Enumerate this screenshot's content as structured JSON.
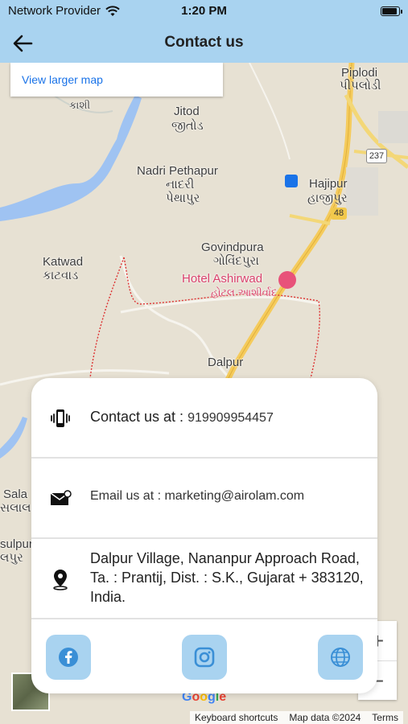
{
  "status_bar": {
    "carrier": "Network Provider",
    "time": "1:20 PM",
    "battery_level": 0.95
  },
  "header": {
    "title": "Contact us",
    "back_icon": "arrow-left-icon"
  },
  "map": {
    "view_larger_map": "View larger map",
    "labels": {
      "kashi": "કાશી",
      "piplodi": "Piplodi",
      "piplodi_gu": "પીપલોડી",
      "jitod": "Jitod",
      "jitod_gu": "જીતોડ",
      "nadri": "Nadri Pethapur",
      "nadri_gu": "નાદરી",
      "pethapur_gu": "પેથાપુર",
      "hajipur": "Hajipur",
      "hajipur_gu": "હાજીપુર",
      "govindpura": "Govindpura",
      "govindpura_gu": "ગોવિંદપુરા",
      "katwad": "Katwad",
      "katwad_gu": "કાટવાડ",
      "hotel": "Hotel Ashirwad",
      "hotel_gu": "હોટલ આશીર્વાદ",
      "dalpur": "Dalpur",
      "sala": "Sala",
      "sala_gu": "સલાલ",
      "sulpur": "sulpur",
      "sulpur_gu": "લપુર",
      "road_237": "237",
      "road_48": "48"
    },
    "zoom_in": "+",
    "zoom_out": "−",
    "google": [
      "G",
      "o",
      "o",
      "g",
      "l",
      "e"
    ],
    "google_colors": [
      "#4285F4",
      "#EA4335",
      "#FBBC05",
      "#4285F4",
      "#34A853",
      "#EA4335"
    ],
    "attribution": {
      "shortcuts": "Keyboard shortcuts",
      "map_data": "Map data ©2024",
      "terms": "Terms"
    }
  },
  "contact": {
    "phone_label": "Contact us at : ",
    "phone_value": "919909954457",
    "email_text": "Email us at : marketing@airolam.com",
    "address": "Dalpur Village, Nananpur Approach Road, Ta. : Prantij, Dist. : S.K., Gujarat + 383120, India."
  },
  "social": {
    "facebook_icon": "facebook-icon",
    "instagram_icon": "instagram-icon",
    "website_icon": "globe-icon"
  },
  "colors": {
    "header_bg": "#a9d3f0",
    "link": "#1a73e8",
    "icon_blue": "#3a8fd6"
  }
}
